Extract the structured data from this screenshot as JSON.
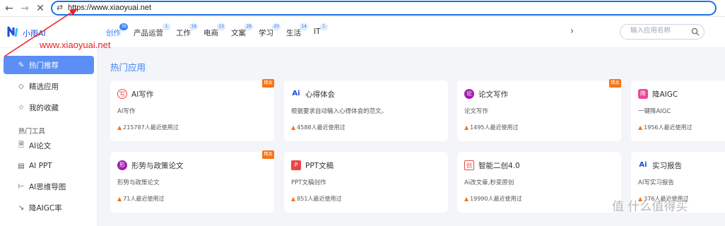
{
  "browser": {
    "url": "https://www.xiaoyuai.net",
    "back_icon": "arrow-left-icon",
    "forward_icon": "arrow-right-icon",
    "close_icon": "close-icon",
    "tune_icon": "tune-icon"
  },
  "header": {
    "logo_text": "小雨AI",
    "nav": [
      {
        "label": "创作",
        "badge": "39"
      },
      {
        "label": "产品运营",
        "badge": "1"
      },
      {
        "label": "工作",
        "badge": "18"
      },
      {
        "label": "电商",
        "badge": "13"
      },
      {
        "label": "文案",
        "badge": "28"
      },
      {
        "label": "学习",
        "badge": "20"
      },
      {
        "label": "生活",
        "badge": "14"
      },
      {
        "label": "IT",
        "badge": "1"
      }
    ],
    "search_placeholder": "输入应用名称"
  },
  "annotation": {
    "text": "www.xiaoyuai.net",
    "color": "#ef2020"
  },
  "sidebar": {
    "items": [
      {
        "label": "热门推荐",
        "icon": "pen-icon"
      },
      {
        "label": "精选应用",
        "icon": "diamond-icon"
      },
      {
        "label": "我的收藏",
        "icon": "star-icon"
      }
    ],
    "section": "热门工具",
    "tools": [
      {
        "label": "AI论文",
        "icon": "document-icon"
      },
      {
        "label": "AI PPT",
        "icon": "ppt-icon"
      },
      {
        "label": "AI思维导图",
        "icon": "mindmap-icon"
      },
      {
        "label": "降AIGC率",
        "icon": "trend-down-icon"
      }
    ]
  },
  "main": {
    "section_title": "热门应用",
    "badge_label": "精品",
    "cards": [
      {
        "icon_text": "写",
        "title": "AI写作",
        "desc": "AI写作",
        "usage": "215787人最近使用过",
        "badge": true
      },
      {
        "icon_text": "Ai",
        "title": "心得体会",
        "desc": "根据要求自动输入心得体会的范文。",
        "usage": "4588人最近使用过",
        "badge": false
      },
      {
        "icon_text": "论",
        "title": "论文写作",
        "desc": "论文写作",
        "usage": "1495人最近使用过",
        "badge": true
      },
      {
        "icon_text": "降",
        "title": "降AIGC",
        "desc": "一键降AIGC",
        "usage": "1956人最近使用过",
        "badge": false
      },
      {
        "icon_text": "形",
        "title": "形势与政策论文",
        "desc": "形势与政策论文",
        "usage": "71人最近使用过",
        "badge": true
      },
      {
        "icon_text": "P",
        "title": "PPT文稿",
        "desc": "PPT文稿创作",
        "usage": "851人最近使用过",
        "badge": false
      },
      {
        "icon_text": "创",
        "title": "智能二创4.0",
        "desc": "Ai改文章,秒变原创",
        "usage": "19990人最近使用过",
        "badge": false
      },
      {
        "icon_text": "Ai",
        "title": "实习报告",
        "desc": "AI写实习报告",
        "usage": "376人最近使用过",
        "badge": false
      }
    ]
  },
  "watermark": "值 什么值得买",
  "colors": {
    "accent": "#3b82f6",
    "sidebar_active": "#5b8ff5",
    "badge": "#f97316",
    "url_border": "#1a73e8"
  }
}
